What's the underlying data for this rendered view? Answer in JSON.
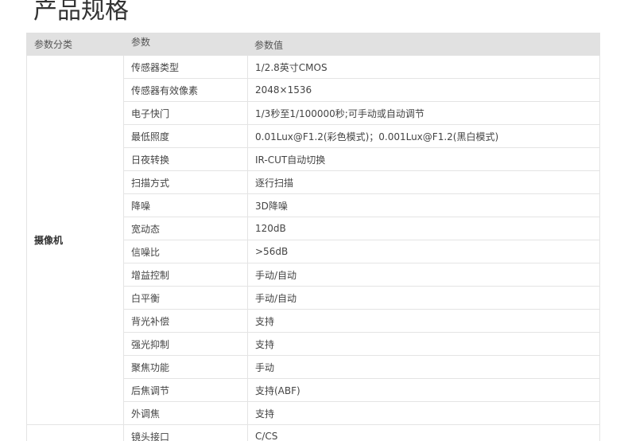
{
  "page_title": "产品规格",
  "table": {
    "headers": {
      "category": "参数分类",
      "param": "参数",
      "value": "参数值"
    },
    "camera_group": {
      "category": "摄像机",
      "rows": [
        {
          "param": "传感器类型",
          "value": "1/2.8英寸CMOS"
        },
        {
          "param": "传感器有效像素",
          "value": "2048×1536"
        },
        {
          "param": "电子快门",
          "value": "1/3秒至1/100000秒;可手动或自动调节"
        },
        {
          "param": "最低照度",
          "value": "0.01Lux@F1.2(彩色模式)；0.001Lux@F1.2(黑白模式)"
        },
        {
          "param": "日夜转换",
          "value": "IR-CUT自动切换"
        },
        {
          "param": "扫描方式",
          "value": "逐行扫描"
        },
        {
          "param": "降噪",
          "value": "3D降噪"
        },
        {
          "param": "宽动态",
          "value": "120dB"
        },
        {
          "param": "信噪比",
          "value": ">56dB"
        },
        {
          "param": "增益控制",
          "value": "手动/自动"
        },
        {
          "param": "白平衡",
          "value": "手动/自动"
        },
        {
          "param": "背光补偿",
          "value": "支持"
        },
        {
          "param": "强光抑制",
          "value": "支持"
        },
        {
          "param": "聚焦功能",
          "value": "手动"
        },
        {
          "param": "后焦调节",
          "value": "支持(ABF)"
        },
        {
          "param": "外调焦",
          "value": "支持"
        }
      ]
    },
    "next_group": {
      "rows": [
        {
          "param": "镜头接口",
          "value": "C/CS"
        }
      ]
    }
  }
}
